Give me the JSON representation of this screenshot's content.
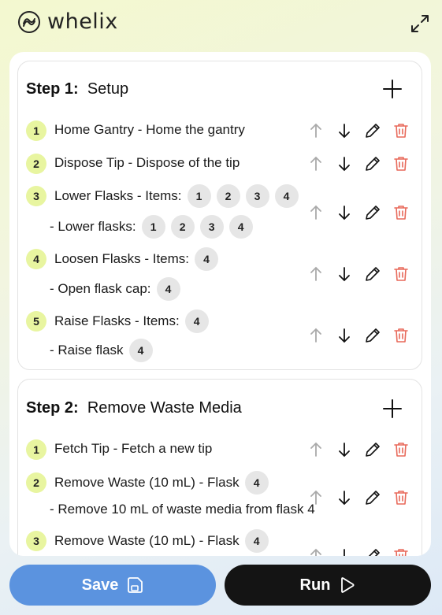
{
  "header": {
    "brand": "whelix"
  },
  "steps": [
    {
      "prefix": "Step 1:",
      "name": "Setup",
      "items": [
        {
          "n": "1",
          "text": "Home Gantry - Home the gantry"
        },
        {
          "n": "2",
          "text": "Dispose Tip - Dispose of the tip"
        },
        {
          "n": "3",
          "text": "Lower Flasks - Items:",
          "chips": [
            "1",
            "2",
            "3",
            "4"
          ],
          "sub": "- Lower flasks:",
          "sub_chips": [
            "1",
            "2",
            "3",
            "4"
          ]
        },
        {
          "n": "4",
          "text": "Loosen Flasks - Items:",
          "chips": [
            "4"
          ],
          "sub": "- Open flask cap:",
          "sub_chips": [
            "4"
          ]
        },
        {
          "n": "5",
          "text": "Raise Flasks - Items:",
          "chips": [
            "4"
          ],
          "sub": "- Raise flask",
          "sub_chips": [
            "4"
          ]
        }
      ]
    },
    {
      "prefix": "Step 2:",
      "name": "Remove Waste Media",
      "items": [
        {
          "n": "1",
          "text": "Fetch Tip - Fetch a new tip"
        },
        {
          "n": "2",
          "text": "Remove Waste (10 mL) - Flask",
          "chips": [
            "4"
          ],
          "sub": "- Remove 10 mL of waste media from flask 4"
        },
        {
          "n": "3",
          "text": "Remove Waste (10 mL) - Flask",
          "chips": [
            "4"
          ]
        }
      ]
    }
  ],
  "footer": {
    "save_label": "Save",
    "run_label": "Run"
  },
  "colors": {
    "accent_green": "#e8f5a0",
    "save_blue": "#5b93df",
    "run_black": "#141414",
    "delete_red": "#e8695a"
  },
  "icons": [
    "whelix-logo-icon",
    "expand-icon",
    "plus-icon",
    "arrow-up-icon",
    "arrow-down-icon",
    "pencil-icon",
    "trash-icon",
    "save-icon",
    "play-icon"
  ]
}
